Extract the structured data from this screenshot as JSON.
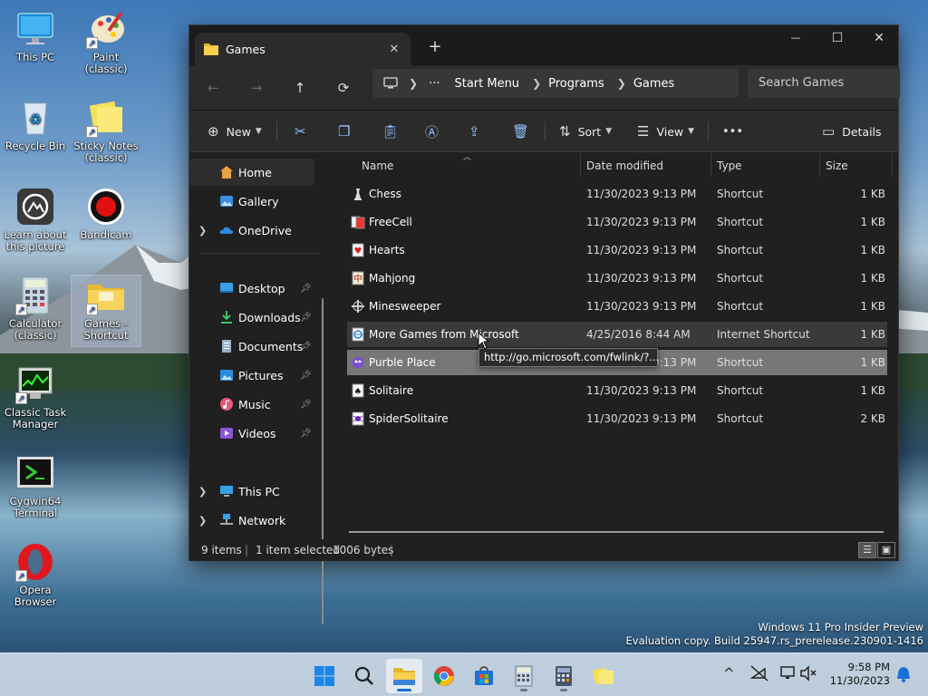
{
  "desktop": {
    "icons": [
      {
        "label": "This PC"
      },
      {
        "label": "Paint (classic)"
      },
      {
        "label": "Recycle Bin"
      },
      {
        "label": "Sticky Notes (classic)"
      },
      {
        "label": "Learn about this picture"
      },
      {
        "label": "Bandicam"
      },
      {
        "label": "Calculator (classic)"
      },
      {
        "label": "Games - Shortcut"
      },
      {
        "label": "Classic Task Manager"
      },
      {
        "label": "Cygwin64 Terminal"
      },
      {
        "label": "Opera Browser"
      }
    ],
    "watermark": {
      "line1": "Windows 11 Pro Insider Preview",
      "line2": "Evaluation copy. Build 25947.rs_prerelease.230901-1416"
    }
  },
  "explorer": {
    "tab_title": "Games",
    "tab_close": "✕",
    "new_tab": "+",
    "window_controls": {
      "minimize": "—",
      "maximize": "☐",
      "close": "✕"
    },
    "nav": {
      "back": "←",
      "forward": "→",
      "up": "↑",
      "refresh": "⟳"
    },
    "breadcrumb": {
      "more": "···",
      "items": [
        "Start Menu",
        "Programs",
        "Games"
      ]
    },
    "search_placeholder": "Search Games",
    "toolbar": {
      "new_label": "New",
      "sort_label": "Sort",
      "view_label": "View",
      "more_label": "•••",
      "details_label": "Details"
    },
    "sidebar": {
      "home": "Home",
      "gallery": "Gallery",
      "onedrive": "OneDrive",
      "desktop": "Desktop",
      "downloads": "Downloads",
      "documents": "Documents",
      "pictures": "Pictures",
      "music": "Music",
      "videos": "Videos",
      "this_pc": "This PC",
      "network": "Network"
    },
    "columns": {
      "name": "Name",
      "date": "Date modified",
      "type": "Type",
      "size": "Size"
    },
    "files": [
      {
        "name": "Chess",
        "date": "11/30/2023 9:13 PM",
        "type": "Shortcut",
        "size": "1 KB"
      },
      {
        "name": "FreeCell",
        "date": "11/30/2023 9:13 PM",
        "type": "Shortcut",
        "size": "1 KB"
      },
      {
        "name": "Hearts",
        "date": "11/30/2023 9:13 PM",
        "type": "Shortcut",
        "size": "1 KB"
      },
      {
        "name": "Mahjong",
        "date": "11/30/2023 9:13 PM",
        "type": "Shortcut",
        "size": "1 KB"
      },
      {
        "name": "Minesweeper",
        "date": "11/30/2023 9:13 PM",
        "type": "Shortcut",
        "size": "1 KB"
      },
      {
        "name": "More Games from Microsoft",
        "date": "4/25/2016 8:44 AM",
        "type": "Internet Shortcut",
        "size": "1 KB"
      },
      {
        "name": "Purble Place",
        "date": "11/30/2023 9:13 PM",
        "type": "Shortcut",
        "size": "1 KB"
      },
      {
        "name": "Solitaire",
        "date": "11/30/2023 9:13 PM",
        "type": "Shortcut",
        "size": "1 KB"
      },
      {
        "name": "SpiderSolitaire",
        "date": "11/30/2023 9:13 PM",
        "type": "Shortcut",
        "size": "2 KB"
      }
    ],
    "tooltip": "http://go.microsoft.com/fwlink/?...",
    "status": {
      "items": "9 items",
      "selected": "1 item selected",
      "bytes": "1006 bytes"
    }
  },
  "taskbar": {
    "clock_time": "9:58 PM",
    "clock_date": "11/30/2023",
    "tray_chevron": "^"
  },
  "colors": {
    "accent": "#1a6fd6",
    "window_bg": "#202020",
    "selected_row": "#777777"
  }
}
